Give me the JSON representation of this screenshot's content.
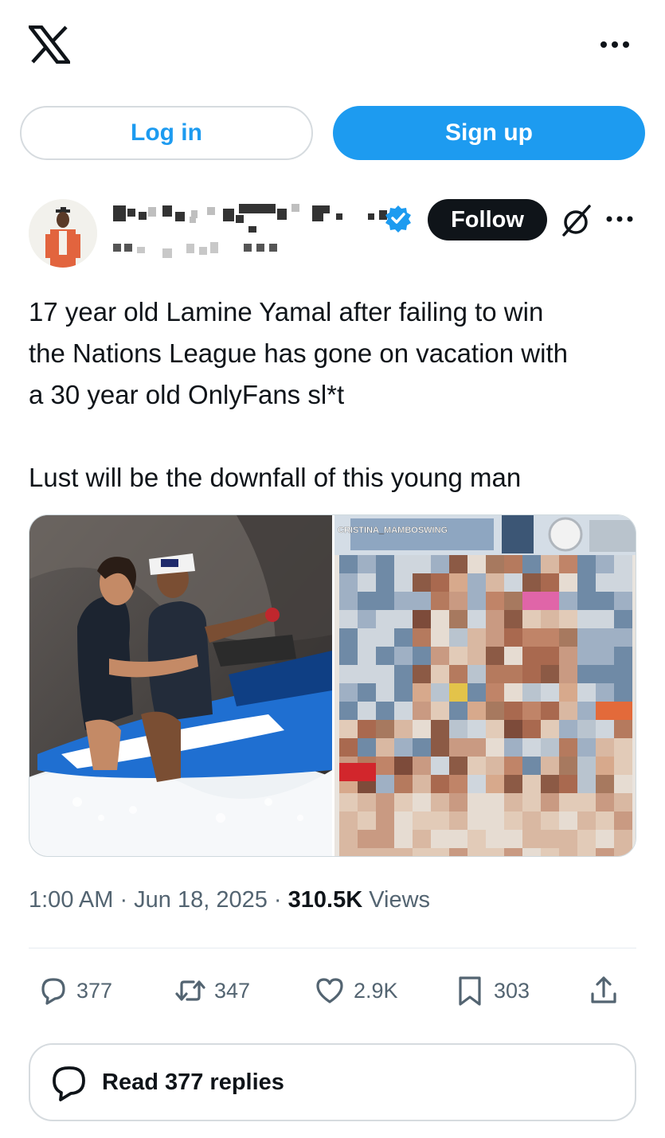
{
  "header": {
    "logo_icon": "x-logo-icon",
    "more_icon": "more-horizontal-icon"
  },
  "auth": {
    "login_label": "Log in",
    "signup_label": "Sign up"
  },
  "post": {
    "follow_label": "Follow",
    "text_lines": [
      "17 year old Lamine Yamal after failing to win",
      "the Nations League has gone on vacation with",
      "a 30 year old OnlyFans sl*t",
      "Lust will be the downfall of this young man"
    ],
    "media_watermark": "CRISTINA_MAMBOSWING",
    "timestamp": "1:00 AM · Jun 18, 2025 · ",
    "views_count": "310.5K",
    "views_label": " Views"
  },
  "actions": {
    "replies": "377",
    "reposts": "347",
    "likes": "2.9K",
    "bookmarks": "303"
  },
  "read_replies_label": "Read 377 replies",
  "colors": {
    "accent": "#1d9bf0",
    "text": "#0f1419",
    "secondary": "#536471",
    "verified": "#1d9bf0"
  }
}
